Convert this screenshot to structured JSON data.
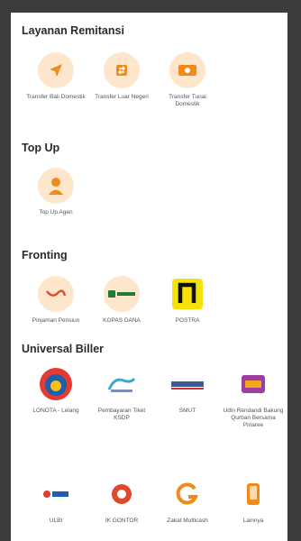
{
  "sections": [
    {
      "title": "Layanan Remitansi",
      "items": [
        {
          "label": "Transfer Bali Domestik",
          "icon": "send-arrow-icon"
        },
        {
          "label": "Transfer Luar Negeri",
          "icon": "transfer-exchange-icon"
        },
        {
          "label": "Transfer Tunai Domestik",
          "icon": "cash-icon"
        }
      ]
    },
    {
      "title": "Top Up",
      "items": [
        {
          "label": "Top Up Agen",
          "icon": "agent-person-icon"
        }
      ]
    },
    {
      "title": "Fronting",
      "items": [
        {
          "label": "Pinjaman Pensiun",
          "icon": "pension-loan-icon"
        },
        {
          "label": "KOPAS DANA",
          "icon": "kopas-logo-icon"
        },
        {
          "label": "POSTRA",
          "icon": "postra-logo-icon"
        }
      ]
    },
    {
      "title": "Universal Biller",
      "items": [
        {
          "label": "LONOTA - Lelang",
          "icon": "lonota-logo-icon"
        },
        {
          "label": "Pembayaran Tiket KSDP",
          "icon": "ksdp-logo-icon"
        },
        {
          "label": "SMUT",
          "icon": "smut-logo-icon"
        },
        {
          "label": "Udin Rendandi Bakung Qurban Bersama Pinaree",
          "icon": "qurban-logo-icon"
        },
        {
          "label": "ULBI",
          "icon": "ulbi-logo-icon"
        },
        {
          "label": "IK GONTOR",
          "icon": "gontor-logo-icon"
        },
        {
          "label": "Zakat Multicash",
          "icon": "zakat-logo-icon"
        },
        {
          "label": "Lainnya",
          "icon": "phone-other-icon"
        }
      ]
    }
  ]
}
